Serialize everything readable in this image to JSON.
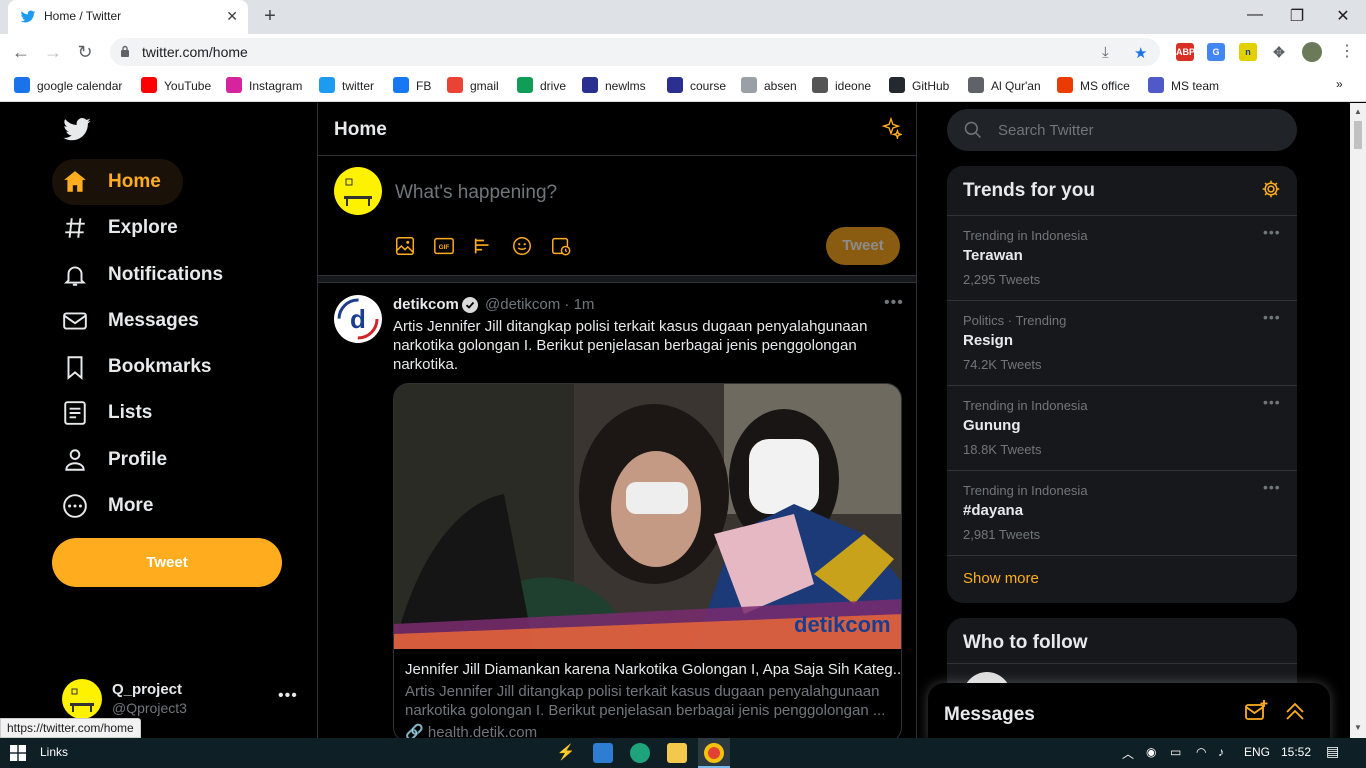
{
  "browser": {
    "tab_title": "Home / Twitter",
    "url": "twitter.com/home",
    "status_url": "https://twitter.com/home",
    "extensions": [
      {
        "name": "adblock-icon",
        "badge": "3"
      }
    ]
  },
  "bookmarks": [
    {
      "label": "google calendar",
      "icon": "calendar-icon",
      "color": "#1a73e8"
    },
    {
      "label": "YouTube",
      "icon": "youtube-icon",
      "color": "#ff0000"
    },
    {
      "label": "Instagram",
      "icon": "instagram-icon",
      "color": "#d6249f"
    },
    {
      "label": "twitter",
      "icon": "twitter-icon",
      "color": "#1d9bf0"
    },
    {
      "label": "FB",
      "icon": "facebook-icon",
      "color": "#1877f2"
    },
    {
      "label": "gmail",
      "icon": "gmail-icon",
      "color": "#ea4335"
    },
    {
      "label": "drive",
      "icon": "drive-icon",
      "color": "#0f9d58"
    },
    {
      "label": "newlms",
      "icon": "lms-icon",
      "color": "#2b2f8f"
    },
    {
      "label": "course",
      "icon": "course-icon",
      "color": "#2b2f8f"
    },
    {
      "label": "absen",
      "icon": "document-icon",
      "color": "#9aa0a6"
    },
    {
      "label": "ideone",
      "icon": "ideone-icon",
      "color": "#555555"
    },
    {
      "label": "GitHub",
      "icon": "github-icon",
      "color": "#24292f"
    },
    {
      "label": "Al Qur'an",
      "icon": "globe-icon",
      "color": "#5f6368"
    },
    {
      "label": "MS office",
      "icon": "office-icon",
      "color": "#eb3c00"
    },
    {
      "label": "MS team",
      "icon": "teams-icon",
      "color": "#5059c9"
    }
  ],
  "sidebar": {
    "items": [
      {
        "label": "Home",
        "icon": "home-icon",
        "active": true
      },
      {
        "label": "Explore",
        "icon": "hashtag-icon"
      },
      {
        "label": "Notifications",
        "icon": "bell-icon"
      },
      {
        "label": "Messages",
        "icon": "envelope-icon"
      },
      {
        "label": "Bookmarks",
        "icon": "bookmark-icon"
      },
      {
        "label": "Lists",
        "icon": "list-icon"
      },
      {
        "label": "Profile",
        "icon": "person-icon"
      },
      {
        "label": "More",
        "icon": "more-circle-icon"
      }
    ],
    "tweet_button": "Tweet",
    "account": {
      "name": "Q_project",
      "handle": "@Qproject3"
    }
  },
  "timeline": {
    "title": "Home",
    "compose": {
      "placeholder": "What's happening?",
      "tweet_button": "Tweet"
    },
    "tweet": {
      "name": "detikcom",
      "handle": "@detikcom",
      "time": "1m",
      "text": "Artis Jennifer Jill ditangkap polisi terkait kasus dugaan penyalahgunaan narkotika golongan I. Berikut penjelasan berbagai jenis penggolongan narkotika.",
      "card": {
        "brand": "detikcom",
        "title": "Jennifer Jill Diamankan karena Narkotika Golongan I, Apa Saja Sih Kateg...",
        "description": "Artis Jennifer Jill ditangkap polisi terkait kasus dugaan penyalahgunaan narkotika golongan I. Berikut penjelasan berbagai jenis penggolongan ...",
        "domain": "health.detik.com"
      }
    }
  },
  "right": {
    "search_placeholder": "Search Twitter",
    "trends_title": "Trends for you",
    "trends": [
      {
        "context": "Trending in Indonesia",
        "name": "Terawan",
        "count": "2,295 Tweets"
      },
      {
        "context": "Politics · Trending",
        "name": "Resign",
        "count": "74.2K Tweets"
      },
      {
        "context": "Trending in Indonesia",
        "name": "Gunung",
        "count": "18.8K Tweets"
      },
      {
        "context": "Trending in Indonesia",
        "name": "#dayana",
        "count": "2,981 Tweets"
      }
    ],
    "show_more": "Show more",
    "who_to_follow": "Who to follow",
    "messages_drawer": "Messages"
  },
  "taskbar": {
    "links": "Links",
    "lang": "ENG",
    "time": "15:52"
  },
  "colors": {
    "accent": "#ffad1f",
    "background": "#000000",
    "text": "#e7e9ea",
    "muted": "#71767b"
  }
}
